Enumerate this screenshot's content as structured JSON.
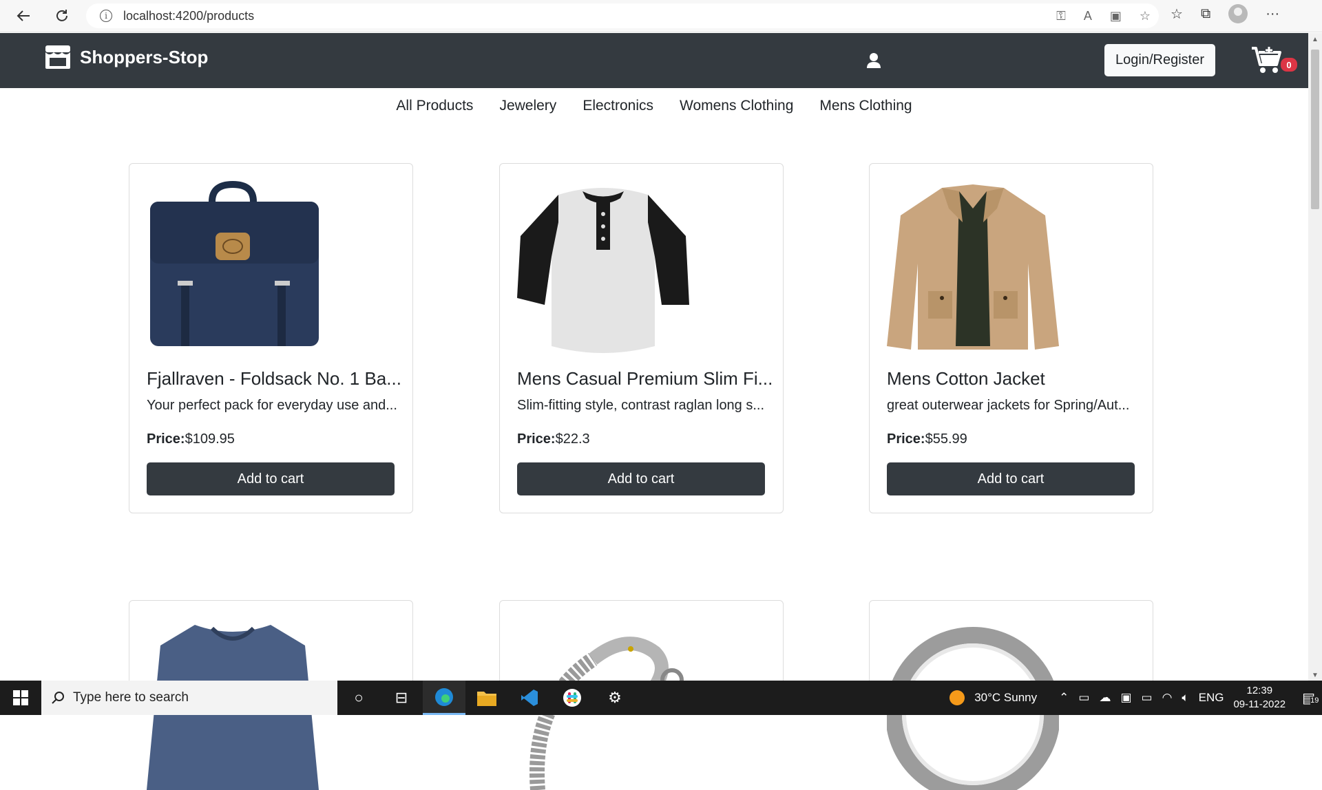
{
  "browser": {
    "url": "localhost:4200/products"
  },
  "header": {
    "brand": "Shoppers-Stop",
    "login_label": "Login/Register",
    "cart_count": "0"
  },
  "categories": [
    "All Products",
    "Jewelery",
    "Electronics",
    "Womens Clothing",
    "Mens Clothing"
  ],
  "products": [
    {
      "title": "Fjallraven - Foldsack No. 1 Ba...",
      "desc": "Your perfect pack for everyday use and...",
      "price_label": "Price:",
      "price": "$109.95",
      "button": "Add to cart",
      "image": "backpack"
    },
    {
      "title": "Mens Casual Premium Slim Fi...",
      "desc": "Slim-fitting style, contrast raglan long s...",
      "price_label": "Price:",
      "price": "$22.3",
      "button": "Add to cart",
      "image": "raglan-tshirt"
    },
    {
      "title": "Mens Cotton Jacket",
      "desc": "great outerwear jackets for Spring/Aut...",
      "price_label": "Price:",
      "price": "$55.99",
      "button": "Add to cart",
      "image": "cotton-jacket"
    },
    {
      "image": "blue-tshirt"
    },
    {
      "image": "dragon-bracelet"
    },
    {
      "image": "silver-ring"
    }
  ],
  "taskbar": {
    "search_placeholder": "Type here to search",
    "weather": "30°C  Sunny",
    "language": "ENG",
    "time": "12:39",
    "date": "09-11-2022",
    "notifications": "19"
  },
  "colors": {
    "header_bg": "#343a40",
    "button_bg": "#343a40",
    "badge": "#dc3545"
  }
}
